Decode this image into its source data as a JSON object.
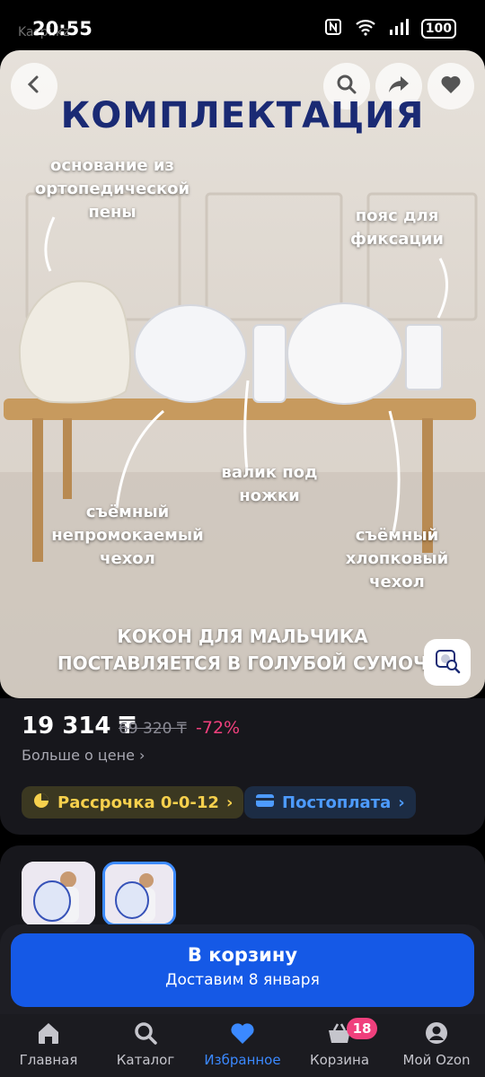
{
  "status": {
    "time": "20:55",
    "watermark": "Kaspi.kz",
    "battery": "100"
  },
  "hero": {
    "title": "КОМПЛЕКТАЦИЯ",
    "labels": {
      "base": [
        "основание из",
        "ортопедической",
        "пены"
      ],
      "belt": [
        "пояс для",
        "фиксации"
      ],
      "cover_waterproof": [
        "съёмный",
        "непромокаемый",
        "чехол"
      ],
      "roller": [
        "валик под",
        "ножки"
      ],
      "cover_cotton": [
        "съёмный",
        "хлопковый",
        "чехол"
      ]
    },
    "bottom": [
      "КОКОН ДЛЯ МАЛЬЧИКА",
      "ПОСТАВЛЯЕТСЯ В ГОЛУБОЙ СУМОЧ"
    ]
  },
  "price": {
    "current": "19 314 ₸",
    "old": "69 320 ₸",
    "discount": "-72%",
    "more": "Больше о цене"
  },
  "chips": {
    "installment": "Рассрочка 0-0-12",
    "postpay": "Постоплата"
  },
  "cart": {
    "title": "В корзину",
    "subtitle": "Доставим 8 января"
  },
  "nav": [
    {
      "label": "Главная",
      "icon": "home-icon"
    },
    {
      "label": "Каталог",
      "icon": "search-icon"
    },
    {
      "label": "Избранное",
      "icon": "heart-icon",
      "active": true
    },
    {
      "label": "Корзина",
      "icon": "basket-icon",
      "badge": "18"
    },
    {
      "label": "Мой Ozon",
      "icon": "profile-icon"
    }
  ],
  "colors": {
    "accent": "#1559e6",
    "active_nav": "#3b89ff",
    "discount": "#f0407d",
    "title_blue": "#1a2a74"
  }
}
